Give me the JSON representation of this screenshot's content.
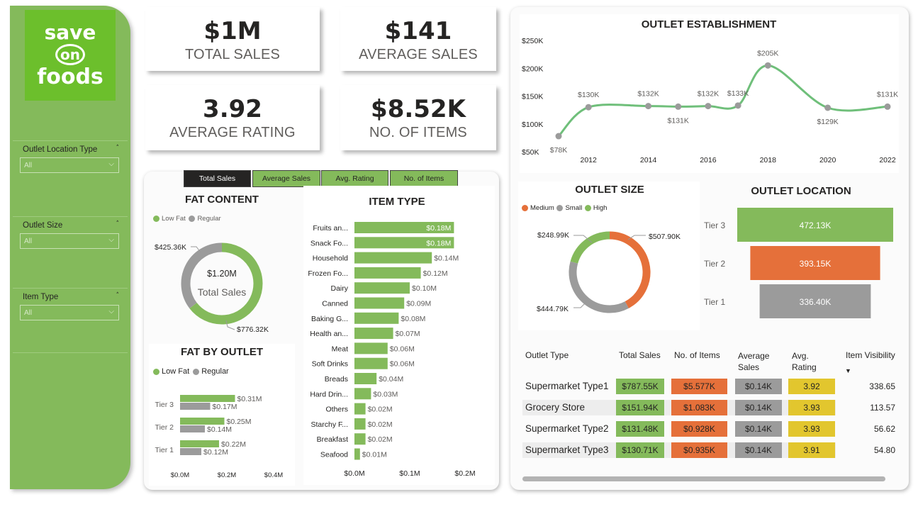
{
  "logo": {
    "line1": "save",
    "line2": "on",
    "line3": "foods"
  },
  "filters": [
    {
      "title": "Outlet Location Type",
      "value": "All"
    },
    {
      "title": "Outlet Size",
      "value": "All"
    },
    {
      "title": "Item Type",
      "value": "All"
    }
  ],
  "kpis": [
    {
      "value": "$1M",
      "label": "TOTAL SALES"
    },
    {
      "value": "$141",
      "label": "AVERAGE SALES"
    },
    {
      "value": "3.92",
      "label": "AVERAGE RATING"
    },
    {
      "value": "$8.52K",
      "label": "NO. OF ITEMS"
    }
  ],
  "tabs": [
    "Total Sales",
    "Average Sales",
    "Avg. Rating",
    "No. of Items"
  ],
  "colors": {
    "green": "#84ba5b",
    "orange": "#e5703a",
    "gray": "#9b9b9b",
    "yellow": "#e2c62e",
    "dark": "#252423"
  },
  "fat_content": {
    "title": "FAT CONTENT",
    "legend": [
      "Low Fat",
      "Regular"
    ],
    "center_value": "$1.20M",
    "center_label": "Total Sales",
    "labels": [
      "$776.32K",
      "$425.36K"
    ]
  },
  "fat_by_outlet": {
    "title": "FAT BY OUTLET",
    "legend": [
      "Low Fat",
      "Regular"
    ],
    "axis": [
      "$0.0M",
      "$0.2M",
      "$0.4M"
    ]
  },
  "item_type": {
    "title": "ITEM TYPE",
    "axis": [
      "$0.0M",
      "$0.1M",
      "$0.2M"
    ]
  },
  "outlet_establishment": {
    "title": "OUTLET ESTABLISHMENT",
    "y_ticks": [
      "$250K",
      "$200K",
      "$150K",
      "$100K",
      "$50K"
    ],
    "x_ticks": [
      "2012",
      "2014",
      "2016",
      "2018",
      "2020",
      "2022"
    ]
  },
  "outlet_size": {
    "title": "OUTLET SIZE",
    "legend": [
      "Medium",
      "Small",
      "High"
    ],
    "labels": [
      "$507.90K",
      "$444.79K",
      "$248.99K"
    ]
  },
  "outlet_location": {
    "title": "OUTLET LOCATION"
  },
  "outlet_table": {
    "headers": [
      "Outlet Type",
      "Total Sales",
      "No. of Items",
      "Average Sales",
      "Avg. Rating",
      "Item Visibility"
    ],
    "rows": [
      [
        "Supermarket Type1",
        "$787.55K",
        "$5.577K",
        "$0.14K",
        "3.92",
        "338.65"
      ],
      [
        "Grocery Store",
        "$151.94K",
        "$1.083K",
        "$0.14K",
        "3.93",
        "113.57"
      ],
      [
        "Supermarket Type2",
        "$131.48K",
        "$0.928K",
        "$0.14K",
        "3.93",
        "56.62"
      ],
      [
        "Supermarket Type3",
        "$130.71K",
        "$0.935K",
        "$0.14K",
        "3.91",
        "54.80"
      ]
    ]
  },
  "chart_data": [
    {
      "type": "pie",
      "title": "FAT CONTENT",
      "categories": [
        "Low Fat",
        "Regular"
      ],
      "values": [
        776.32,
        425.36
      ],
      "labels": [
        "$776.32K",
        "$425.36K"
      ],
      "center_value": "$1.20M",
      "center_label": "Total Sales"
    },
    {
      "type": "bar",
      "title": "FAT BY OUTLET",
      "categories": [
        "Tier 3",
        "Tier 2",
        "Tier 1"
      ],
      "series": [
        {
          "name": "Low Fat",
          "values": [
            0.31,
            0.25,
            0.22
          ],
          "labels": [
            "$0.31M",
            "$0.25M",
            "$0.22M"
          ]
        },
        {
          "name": "Regular",
          "values": [
            0.17,
            0.14,
            0.12
          ],
          "labels": [
            "$0.17M",
            "$0.14M",
            "$0.12M"
          ]
        }
      ],
      "xlim": [
        0,
        0.4
      ]
    },
    {
      "type": "bar",
      "title": "ITEM TYPE",
      "categories": [
        "Fruits an...",
        "Snack Fo...",
        "Household",
        "Frozen Fo...",
        "Dairy",
        "Canned",
        "Baking G...",
        "Health an...",
        "Meat",
        "Soft Drinks",
        "Breads",
        "Hard Drin...",
        "Others",
        "Starchy F...",
        "Breakfast",
        "Seafood"
      ],
      "values": [
        0.18,
        0.18,
        0.14,
        0.12,
        0.1,
        0.09,
        0.08,
        0.07,
        0.06,
        0.06,
        0.04,
        0.03,
        0.02,
        0.02,
        0.02,
        0.01
      ],
      "labels": [
        "$0.18M",
        "$0.18M",
        "$0.14M",
        "$0.12M",
        "$0.10M",
        "$0.09M",
        "$0.08M",
        "$0.07M",
        "$0.06M",
        "$0.06M",
        "$0.04M",
        "$0.03M",
        "$0.02M",
        "$0.02M",
        "$0.02M",
        "$0.01M"
      ],
      "xlim": [
        0,
        0.2
      ]
    },
    {
      "type": "line",
      "title": "OUTLET ESTABLISHMENT",
      "x": [
        2011,
        2012,
        2014,
        2015,
        2016,
        2017,
        2018,
        2020,
        2022
      ],
      "values": [
        78,
        130,
        132,
        131,
        132,
        133,
        205,
        129,
        131
      ],
      "labels": [
        "$78K",
        "$130K",
        "$132K",
        "$131K",
        "$132K",
        "$133K",
        "$205K",
        "$129K",
        "$131K"
      ],
      "ylim": [
        50,
        250
      ]
    },
    {
      "type": "pie",
      "title": "OUTLET SIZE",
      "categories": [
        "Medium",
        "Small",
        "High"
      ],
      "values": [
        507.9,
        444.79,
        248.99
      ],
      "labels": [
        "$507.90K",
        "$444.79K",
        "$248.99K"
      ]
    },
    {
      "type": "bar",
      "title": "OUTLET LOCATION",
      "categories": [
        "Tier 3",
        "Tier 2",
        "Tier 1"
      ],
      "values": [
        472.13,
        393.15,
        336.4
      ],
      "labels": [
        "472.13K",
        "393.15K",
        "336.40K"
      ]
    }
  ]
}
